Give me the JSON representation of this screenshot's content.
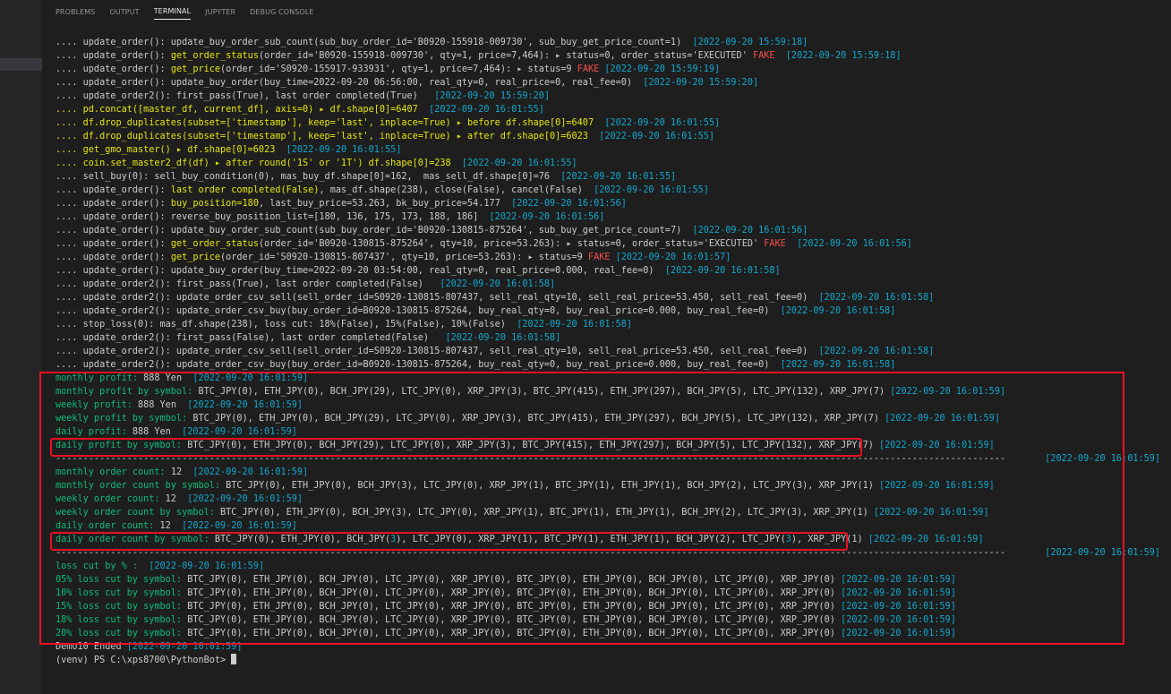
{
  "tabs": [
    "PROBLEMS",
    "OUTPUT",
    "TERMINAL",
    "JUPYTER",
    "DEBUG CONSOLE"
  ],
  "active_tab": "TERMINAL",
  "lines": [
    [
      {
        "t": ".... update_order(): update_buy_order_sub_count(sub_buy_order_id='B0920-155918-009730', sub_buy_get_price_count=1)  ",
        "c": "w"
      },
      {
        "t": "[2022-09-20 15:59:18]",
        "c": "c"
      }
    ],
    [
      {
        "t": ".... update_order(): ",
        "c": "w"
      },
      {
        "t": "get_order_status",
        "c": "y"
      },
      {
        "t": "(order_id='B0920-155918-009730', qty=1, price=7,464): ▸ status=0, order_status='EXECUTED' ",
        "c": "w"
      },
      {
        "t": "FAKE",
        "c": "r"
      },
      {
        "t": "  ",
        "c": "w"
      },
      {
        "t": "[2022-09-20 15:59:18]",
        "c": "c"
      }
    ],
    [
      {
        "t": ".... update_order(): ",
        "c": "w"
      },
      {
        "t": "get_price",
        "c": "y"
      },
      {
        "t": "(order_id='S0920-155917-933931', qty=1, price=7,464): ▸ status=9 ",
        "c": "w"
      },
      {
        "t": "FAKE",
        "c": "r"
      },
      {
        "t": " ",
        "c": "w"
      },
      {
        "t": "[2022-09-20 15:59:19]",
        "c": "c"
      }
    ],
    [
      {
        "t": ".... update_order(): update_buy_order(buy_time=2022-09-20 06:56:00, real_qty=0, real_price=0, real_fee=0)  ",
        "c": "w"
      },
      {
        "t": "[2022-09-20 15:59:20]",
        "c": "c"
      }
    ],
    [
      {
        "t": ".... update_order2(): first_pass(True), last order completed(True)   ",
        "c": "w"
      },
      {
        "t": "[2022-09-20 15:59:20]",
        "c": "c"
      }
    ],
    [
      {
        "t": ".... pd.concat([master_df, current_df], axis=0) ▸ df.shape[0]=6407  ",
        "c": "y"
      },
      {
        "t": "[2022-09-20 16:01:55]",
        "c": "c"
      }
    ],
    [
      {
        "t": ".... df.drop_duplicates(subset=['timestamp'], keep='last', inplace=True) ▸ before df.shape[0]=6407  ",
        "c": "y"
      },
      {
        "t": "[2022-09-20 16:01:55]",
        "c": "c"
      }
    ],
    [
      {
        "t": ".... df.drop_duplicates(subset=['timestamp'], keep='last', inplace=True) ▸ after df.shape[0]=6023  ",
        "c": "y"
      },
      {
        "t": "[2022-09-20 16:01:55]",
        "c": "c"
      }
    ],
    [
      {
        "t": ".... get_gmo_master() ▸ df.shape[0]=6023  ",
        "c": "y"
      },
      {
        "t": "[2022-09-20 16:01:55]",
        "c": "c"
      }
    ],
    [
      {
        "t": ".... coin.set_master2_df(df) ▸ after round('1S' or '1T') df.shape[0]=238  ",
        "c": "y"
      },
      {
        "t": "[2022-09-20 16:01:55]",
        "c": "c"
      }
    ],
    [
      {
        "t": ".... sell_buy(0): sell_buy_condition(0), mas_buy_df.shape[0]=162,  mas_sell_df.shape[0]=76  ",
        "c": "w"
      },
      {
        "t": "[2022-09-20 16:01:55]",
        "c": "c"
      }
    ],
    [
      {
        "t": ".... update_order(): ",
        "c": "w"
      },
      {
        "t": "last order completed(False)",
        "c": "y"
      },
      {
        "t": ", mas_df.shape(238), close(False), cancel(False)  ",
        "c": "w"
      },
      {
        "t": "[2022-09-20 16:01:55]",
        "c": "c"
      }
    ],
    [
      {
        "t": ".... update_order(): ",
        "c": "w"
      },
      {
        "t": "buy_position=180",
        "c": "y"
      },
      {
        "t": ", last_buy_price=53.263, bk_buy_price=54.177  ",
        "c": "w"
      },
      {
        "t": "[2022-09-20 16:01:56]",
        "c": "c"
      }
    ],
    [
      {
        "t": ".... update_order(): reverse_buy_position_list=[180, 136, 175, 173, 188, 186]  ",
        "c": "w"
      },
      {
        "t": "[2022-09-20 16:01:56]",
        "c": "c"
      }
    ],
    [
      {
        "t": ".... update_order(): update_buy_order_sub_count(sub_buy_order_id='B0920-130815-875264', sub_buy_get_price_count=7)  ",
        "c": "w"
      },
      {
        "t": "[2022-09-20 16:01:56]",
        "c": "c"
      }
    ],
    [
      {
        "t": ".... update_order(): ",
        "c": "w"
      },
      {
        "t": "get_order_status",
        "c": "y"
      },
      {
        "t": "(order_id='B0920-130815-875264', qty=10, price=53.263): ▸ status=0, order_status='EXECUTED' ",
        "c": "w"
      },
      {
        "t": "FAKE",
        "c": "r"
      },
      {
        "t": "  ",
        "c": "w"
      },
      {
        "t": "[2022-09-20 16:01:56]",
        "c": "c"
      }
    ],
    [
      {
        "t": ".... update_order(): ",
        "c": "w"
      },
      {
        "t": "get_price",
        "c": "y"
      },
      {
        "t": "(order_id='S0920-130815-807437', qty=10, price=53.263): ▸ status=9 ",
        "c": "w"
      },
      {
        "t": "FAKE",
        "c": "r"
      },
      {
        "t": " ",
        "c": "w"
      },
      {
        "t": "[2022-09-20 16:01:57]",
        "c": "c"
      }
    ],
    [
      {
        "t": ".... update_order(): update_buy_order(buy_time=2022-09-20 03:54:00, real_qty=0, real_price=0.000, real_fee=0)  ",
        "c": "w"
      },
      {
        "t": "[2022-09-20 16:01:58]",
        "c": "c"
      }
    ],
    [
      {
        "t": ".... update_order2(): first_pass(True), last order completed(False)   ",
        "c": "w"
      },
      {
        "t": "[2022-09-20 16:01:58]",
        "c": "c"
      }
    ],
    [
      {
        "t": ".... update_order2(): update_order_csv_sell(sell_order_id=S0920-130815-807437, sell_real_qty=10, sell_real_price=53.450, sell_real_fee=0)  ",
        "c": "w"
      },
      {
        "t": "[2022-09-20 16:01:58]",
        "c": "c"
      }
    ],
    [
      {
        "t": ".... update_order2(): update_order_csv_buy(buy_order_id=B0920-130815-875264, buy_real_qty=0, buy_real_price=0.000, buy_real_fee=0)  ",
        "c": "w"
      },
      {
        "t": "[2022-09-20 16:01:58]",
        "c": "c"
      }
    ],
    [
      {
        "t": ".... stop_loss(0): mas_df.shape(238), loss cut: 18%(False), 15%(False), 10%(False)  ",
        "c": "w"
      },
      {
        "t": "[2022-09-20 16:01:58]",
        "c": "c"
      }
    ],
    [
      {
        "t": ".... update_order2(): first_pass(False), last order completed(False)   ",
        "c": "w"
      },
      {
        "t": "[2022-09-20 16:01:58]",
        "c": "c"
      }
    ],
    [
      {
        "t": ".... update_order2(): update_order_csv_sell(sell_order_id=S0920-130815-807437, sell_real_qty=10, sell_real_price=53.450, sell_real_fee=0)  ",
        "c": "w"
      },
      {
        "t": "[2022-09-20 16:01:58]",
        "c": "c"
      }
    ],
    [
      {
        "t": ".... update_order2(): update_order_csv_buy(buy_order_id=B0920-130815-875264, buy_real_qty=0, buy_real_price=0.000, buy_real_fee=0)  ",
        "c": "w"
      },
      {
        "t": "[2022-09-20 16:01:58]",
        "c": "c"
      }
    ],
    [
      {
        "t": "monthly profit: ",
        "c": "g"
      },
      {
        "t": "888 Yen  ",
        "c": "w"
      },
      {
        "t": "[2022-09-20 16:01:59]",
        "c": "c"
      }
    ],
    [
      {
        "t": "monthly profit by symbol: ",
        "c": "g"
      },
      {
        "t": "BTC_JPY(0), ETH_JPY(0), BCH_JPY(29), LTC_JPY(0), XRP_JPY(3), BTC_JPY(415), ETH_JPY(297), BCH_JPY(5), LTC_JPY(132), XRP_JPY(7) ",
        "c": "w"
      },
      {
        "t": "[2022-09-20 16:01:59]",
        "c": "c"
      }
    ],
    [
      {
        "t": "weekly profit: ",
        "c": "g"
      },
      {
        "t": "888 Yen  ",
        "c": "w"
      },
      {
        "t": "[2022-09-20 16:01:59]",
        "c": "c"
      }
    ],
    [
      {
        "t": "weekly profit by symbol: ",
        "c": "g"
      },
      {
        "t": "BTC_JPY(0), ETH_JPY(0), BCH_JPY(29), LTC_JPY(0), XRP_JPY(3), BTC_JPY(415), ETH_JPY(297), BCH_JPY(5), LTC_JPY(132), XRP_JPY(7) ",
        "c": "w"
      },
      {
        "t": "[2022-09-20 16:01:59]",
        "c": "c"
      }
    ],
    [
      {
        "t": "daily profit: ",
        "c": "g"
      },
      {
        "t": "888 Yen  ",
        "c": "w"
      },
      {
        "t": "[2022-09-20 16:01:59]",
        "c": "c"
      }
    ],
    [
      {
        "t": "daily profit by symbol: ",
        "c": "g"
      },
      {
        "t": "BTC_JPY(0), ETH_JPY(0), BCH_JPY(29), LTC_JPY(0), XRP_JPY(3), BTC_JPY(415), ETH_JPY(297), BCH_JPY(5), LTC_JPY(132), XRP_JPY(7) ",
        "c": "w"
      },
      {
        "t": "[2022-09-20 16:01:59]",
        "c": "c"
      }
    ],
    [
      {
        "t": "------------------------------------------------------------------------------------------------------------------------------------------------------------------------------------------------------------------------------------------------------------------ ",
        "c": "w",
        "dash": true
      },
      {
        "t": "[2022-09-20 16:01:59]",
        "c": "c",
        "right": true
      }
    ],
    [
      {
        "t": "monthly order count: ",
        "c": "g"
      },
      {
        "t": "12  ",
        "c": "w"
      },
      {
        "t": "[2022-09-20 16:01:59]",
        "c": "c"
      }
    ],
    [
      {
        "t": "monthly order count by symbol: ",
        "c": "g"
      },
      {
        "t": "BTC_JPY(0), ETH_JPY(0), BCH_JPY(3), LTC_JPY(0), XRP_JPY(1), BTC_JPY(1), ETH_JPY(1), BCH_JPY(2), LTC_JPY(3), XRP_JPY(1) ",
        "c": "w"
      },
      {
        "t": "[2022-09-20 16:01:59]",
        "c": "c"
      }
    ],
    [
      {
        "t": "weekly order count: ",
        "c": "g"
      },
      {
        "t": "12  ",
        "c": "w"
      },
      {
        "t": "[2022-09-20 16:01:59]",
        "c": "c"
      }
    ],
    [
      {
        "t": "weekly order count by symbol: ",
        "c": "g"
      },
      {
        "t": "BTC_JPY(0), ETH_JPY(0), BCH_JPY(3), LTC_JPY(0), XRP_JPY(1), BTC_JPY(1), ETH_JPY(1), BCH_JPY(2), LTC_JPY(3), XRP_JPY(1) ",
        "c": "w"
      },
      {
        "t": "[2022-09-20 16:01:59]",
        "c": "c"
      }
    ],
    [
      {
        "t": "daily order count: ",
        "c": "g"
      },
      {
        "t": "12  ",
        "c": "w"
      },
      {
        "t": "[2022-09-20 16:01:59]",
        "c": "c"
      }
    ],
    [
      {
        "t": "daily order count by symbol: ",
        "c": "g"
      },
      {
        "t": "BTC_JPY(0), ETH_JPY(0), BCH_JPY(",
        "c": "w"
      },
      {
        "t": "3",
        "c": "c"
      },
      {
        "t": "), LTC_JPY(0), XRP_JPY(1), BTC_JPY(1), ETH_JPY(1), BCH_JPY(2), LTC_JPY(",
        "c": "w"
      },
      {
        "t": "3",
        "c": "c"
      },
      {
        "t": "), XRP_JPY(1) ",
        "c": "w"
      },
      {
        "t": "[2022-09-20 16:01:59]",
        "c": "c"
      }
    ],
    [
      {
        "t": "------------------------------------------------------------------------------------------------------------------------------------------------------------------------------------------------------------------------------------------------------------------ ",
        "c": "w",
        "dash": true
      },
      {
        "t": "[2022-09-20 16:01:59]",
        "c": "c",
        "right": true
      }
    ],
    [
      {
        "t": "loss cut by % :  ",
        "c": "g"
      },
      {
        "t": "[2022-09-20 16:01:59]",
        "c": "c"
      }
    ],
    [
      {
        "t": "05% loss cut by symbol: ",
        "c": "g"
      },
      {
        "t": "BTC_JPY(0), ETH_JPY(0), BCH_JPY(0), LTC_JPY(0), XRP_JPY(0), BTC_JPY(0), ETH_JPY(0), BCH_JPY(0), LTC_JPY(0), XRP_JPY(0) ",
        "c": "w"
      },
      {
        "t": "[2022-09-20 16:01:59]",
        "c": "c"
      }
    ],
    [
      {
        "t": "10% loss cut by symbol: ",
        "c": "g"
      },
      {
        "t": "BTC_JPY(0), ETH_JPY(0), BCH_JPY(0), LTC_JPY(0), XRP_JPY(0), BTC_JPY(0), ETH_JPY(0), BCH_JPY(0), LTC_JPY(0), XRP_JPY(0) ",
        "c": "w"
      },
      {
        "t": "[2022-09-20 16:01:59]",
        "c": "c"
      }
    ],
    [
      {
        "t": "15% loss cut by symbol: ",
        "c": "g"
      },
      {
        "t": "BTC_JPY(0), ETH_JPY(0), BCH_JPY(0), LTC_JPY(0), XRP_JPY(0), BTC_JPY(0), ETH_JPY(0), BCH_JPY(0), LTC_JPY(0), XRP_JPY(0) ",
        "c": "w"
      },
      {
        "t": "[2022-09-20 16:01:59]",
        "c": "c"
      }
    ],
    [
      {
        "t": "18% loss cut by symbol: ",
        "c": "g"
      },
      {
        "t": "BTC_JPY(0), ETH_JPY(0), BCH_JPY(0), LTC_JPY(0), XRP_JPY(0), BTC_JPY(0), ETH_JPY(0), BCH_JPY(0), LTC_JPY(0), XRP_JPY(0) ",
        "c": "w"
      },
      {
        "t": "[2022-09-20 16:01:59]",
        "c": "c"
      }
    ],
    [
      {
        "t": "20% loss cut by symbol: ",
        "c": "g"
      },
      {
        "t": "BTC_JPY(0), ETH_JPY(0), BCH_JPY(0), LTC_JPY(0), XRP_JPY(0), BTC_JPY(0), ETH_JPY(0), BCH_JPY(0), LTC_JPY(0), XRP_JPY(0) ",
        "c": "w"
      },
      {
        "t": "[2022-09-20 16:01:59]",
        "c": "c"
      }
    ],
    [
      {
        "t": "Demo10 Ended ",
        "c": "w"
      },
      {
        "t": "[2022-09-20 16:01:59]",
        "c": "c"
      }
    ],
    [
      {
        "t": "(venv) PS C:\\xps8700\\PythonBot> ",
        "c": "w",
        "prompt": true
      }
    ]
  ],
  "colors": {
    "background": "#1e1e1e",
    "yellow": "#e5e510",
    "cyan": "#11a8cd",
    "green": "#0dbc79",
    "red": "#f14c4c",
    "highlight_box": "#e81123"
  }
}
